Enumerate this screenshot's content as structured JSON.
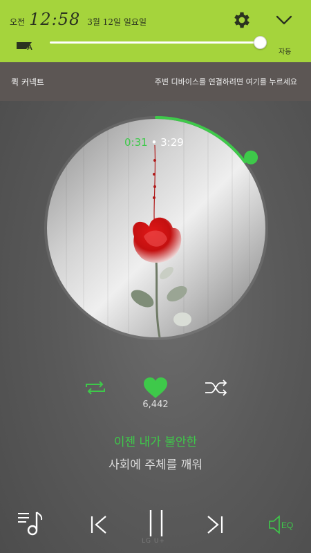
{
  "status": {
    "ampm": "오전",
    "time": "12:58",
    "date": "3월 12일 일요일",
    "brightness_label": "자동",
    "brightness_level": 0.99
  },
  "icons": {
    "settings": "gear-icon",
    "collapse": "chevron-down-icon",
    "auto_brightness": "auto-brightness-icon",
    "repeat": "repeat-icon",
    "like": "heart-icon",
    "shuffle": "shuffle-icon",
    "playlist": "playlist-icon",
    "prev": "previous-icon",
    "pause": "pause-icon",
    "next": "next-icon",
    "eq": "eq-icon"
  },
  "quick_connect": {
    "title": "퀵 커넥트",
    "hint": "주변 디바이스를 연결하려면 여기를 누르세요"
  },
  "player": {
    "current_time": "0:31",
    "separator": "•",
    "total_time": "3:29",
    "progress": 0.148,
    "likes": "6,442",
    "lyric_current": "이젠 내가 불안한",
    "lyric_next": "사회에 주체를 깨워",
    "eq_label": "EQ",
    "bottom_text": "LG U+"
  },
  "colors": {
    "panel": "#a5d43c",
    "accent": "#3ec94a",
    "quick_connect_bg": "#5c5654"
  }
}
